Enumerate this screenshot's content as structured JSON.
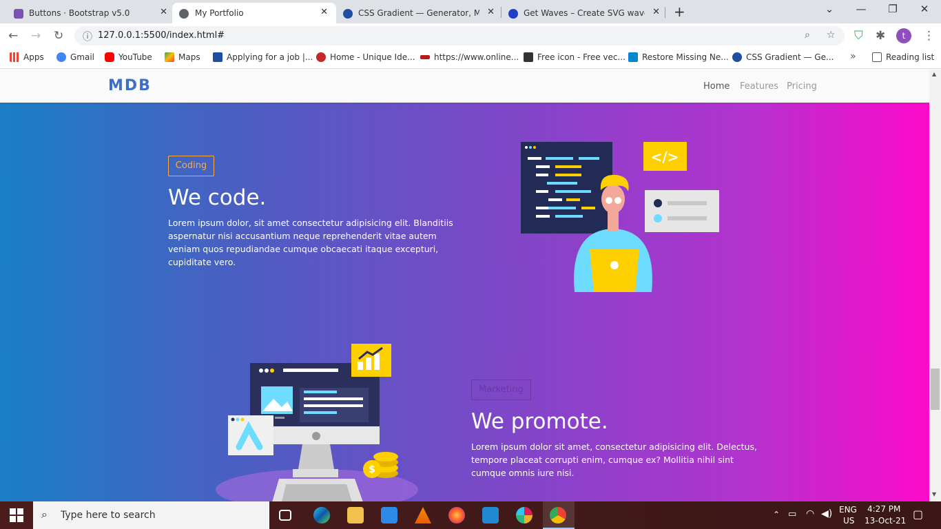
{
  "browser": {
    "tabs": [
      {
        "title": "Buttons · Bootstrap v5.0",
        "color": "#7952b3"
      },
      {
        "title": "My Portfolio",
        "color": "#5f6368"
      },
      {
        "title": "CSS Gradient — Generator, Make",
        "color": "#1e4fa0"
      },
      {
        "title": "Get Waves – Create SVG waves fo",
        "color": "#1d3fc8"
      }
    ],
    "url": "127.0.0.1:5500/index.html#",
    "avatar_letter": "t",
    "bookmarks": [
      {
        "label": "Apps",
        "icon": "apps-grid-icon",
        "color": "#ea4335"
      },
      {
        "label": "Gmail",
        "icon": "google-icon",
        "color": "#4285f4"
      },
      {
        "label": "YouTube",
        "icon": "youtube-icon",
        "color": "#ff0000"
      },
      {
        "label": "Maps",
        "icon": "maps-icon",
        "color": "#34a853"
      },
      {
        "label": "Applying for a job |...",
        "icon": "c-icon",
        "color": "#1e4fa0"
      },
      {
        "label": "Home - Unique Ide...",
        "icon": "fingerprint-icon",
        "color": "#c62828"
      },
      {
        "label": "https://www.online...",
        "icon": "nsdl-icon",
        "color": "#b71c1c"
      },
      {
        "label": "Free icon - Free vec...",
        "icon": "flaticon-icon",
        "color": "#333333"
      },
      {
        "label": "Restore Missing Ne...",
        "icon": "restore-icon",
        "color": "#0288d1"
      },
      {
        "label": "CSS Gradient — Ge...",
        "icon": "gradient-icon",
        "color": "#1e4fa0"
      }
    ],
    "more_label": "»",
    "reading_list": "Reading list"
  },
  "site": {
    "logo": "MDB",
    "nav": [
      "Home",
      "Features",
      "Pricing"
    ],
    "sections": [
      {
        "badge": "Coding",
        "badge_color": "#ffa940",
        "title": "We code.",
        "text": "Lorem ipsum dolor, sit amet consectetur adipisicing elit. Blanditiis aspernatur nisi accusantium neque reprehenderit vitae autem veniam quos repudiandae cumque obcaecati itaque excepturi, cupiditate vero."
      },
      {
        "badge": "Marketing",
        "badge_color": "#7a3ab0",
        "title": "We promote.",
        "text": "Lorem ipsum dolor sit amet, consectetur adipisicing elit. Delectus, tempore placeat corrupti enim, cumque ex? Mollitia nihil sint cumque omnis iure nisi."
      }
    ]
  },
  "taskbar": {
    "search_placeholder": "Type here to search",
    "lang_top": "ENG",
    "lang_bottom": "US",
    "time": "4:27 PM",
    "date": "13-Oct-21"
  }
}
